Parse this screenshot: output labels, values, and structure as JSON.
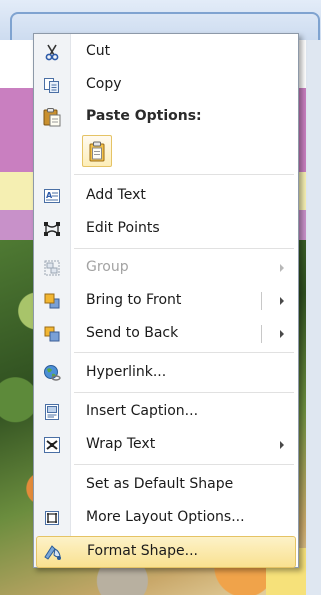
{
  "menu": {
    "items": [
      {
        "name": "cut",
        "label": "Cut",
        "icon": "scissors-icon"
      },
      {
        "name": "copy",
        "label": "Copy",
        "icon": "copy-icon"
      },
      {
        "name": "paste-options",
        "label": "Paste Options:",
        "icon": "paste-icon"
      },
      {
        "name": "add-text",
        "label": "Add Text",
        "icon": "add-text-icon"
      },
      {
        "name": "edit-points",
        "label": "Edit Points",
        "icon": "edit-points-icon"
      },
      {
        "name": "group",
        "label": "Group",
        "icon": "group-icon",
        "disabled": true
      },
      {
        "name": "bring-to-front",
        "label": "Bring to Front",
        "icon": "bring-to-front-icon"
      },
      {
        "name": "send-to-back",
        "label": "Send to Back",
        "icon": "send-to-back-icon"
      },
      {
        "name": "hyperlink",
        "label": "Hyperlink...",
        "icon": "hyperlink-globe-icon"
      },
      {
        "name": "insert-caption",
        "label": "Insert Caption...",
        "icon": "insert-caption-icon"
      },
      {
        "name": "wrap-text",
        "label": "Wrap Text",
        "icon": "wrap-text-icon"
      },
      {
        "name": "set-default-shape",
        "label": "Set as Default Shape",
        "icon": ""
      },
      {
        "name": "more-layout-options",
        "label": "More Layout Options...",
        "icon": "layout-options-icon"
      },
      {
        "name": "format-shape",
        "label": "Format Shape...",
        "icon": "format-shape-icon",
        "selected": true
      }
    ]
  },
  "colors": {
    "highlight": "#f9e190",
    "highlight_border": "#e5c365",
    "pink_band": "#c97fc0",
    "yellow_band": "#f5efb2"
  }
}
